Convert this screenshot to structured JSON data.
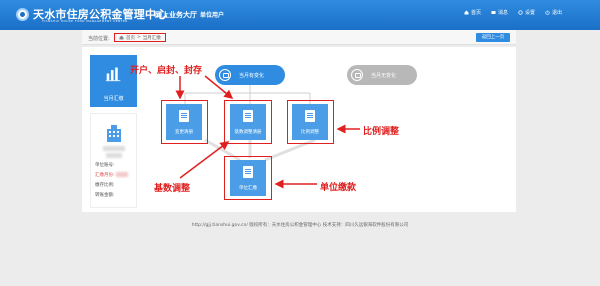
{
  "header": {
    "title": "天水市住房公积金管理中心",
    "subtitle": "TIANSHUI   HOUSE   FUND   MANAGEMENT   CENTER",
    "hall": "网上业务大厅",
    "user_type": "单位用户",
    "nav": [
      {
        "label": "首页",
        "icon": "home-icon"
      },
      {
        "label": "消息",
        "icon": "message-icon"
      },
      {
        "label": "设置",
        "icon": "gear-icon"
      },
      {
        "label": "退出",
        "icon": "power-icon"
      }
    ]
  },
  "breadcrumb": {
    "prefix": "当前位置:",
    "home": "首页",
    "separator": ">",
    "current": "当月汇缴"
  },
  "back_button": "返回上一页",
  "sidebar": {
    "tile_label": "当月汇缴",
    "fields": [
      {
        "label": "单位账号:",
        "highlight": false
      },
      {
        "label": "汇缴月份:",
        "highlight": true
      },
      {
        "label": "缴存比例:",
        "highlight": false
      },
      {
        "label": "转账金额:",
        "highlight": false
      }
    ]
  },
  "flow": {
    "state_changed": "当月有变化",
    "state_unchanged": "当月无变化",
    "ops": {
      "change_list": "变更清册",
      "base_adjust_list": "基数调整清册",
      "ratio_adjust": "比例调整",
      "unit_remit": "单位汇缴"
    }
  },
  "annotations": {
    "open_seal": "开户、启封、封存",
    "ratio_adjust": "比例调整",
    "base_adjust": "基数调整",
    "unit_pay": "单位缴款"
  },
  "colors": {
    "primary": "#2f8ce0",
    "annotation_red": "#e02020",
    "inactive_grey": "#b8b8b8"
  },
  "footer": "http://gjj.tianshui.gov.cn/ 版权所有：天水住房公积金管理中心 技术支持：四川久远银海软件股份有限公司"
}
